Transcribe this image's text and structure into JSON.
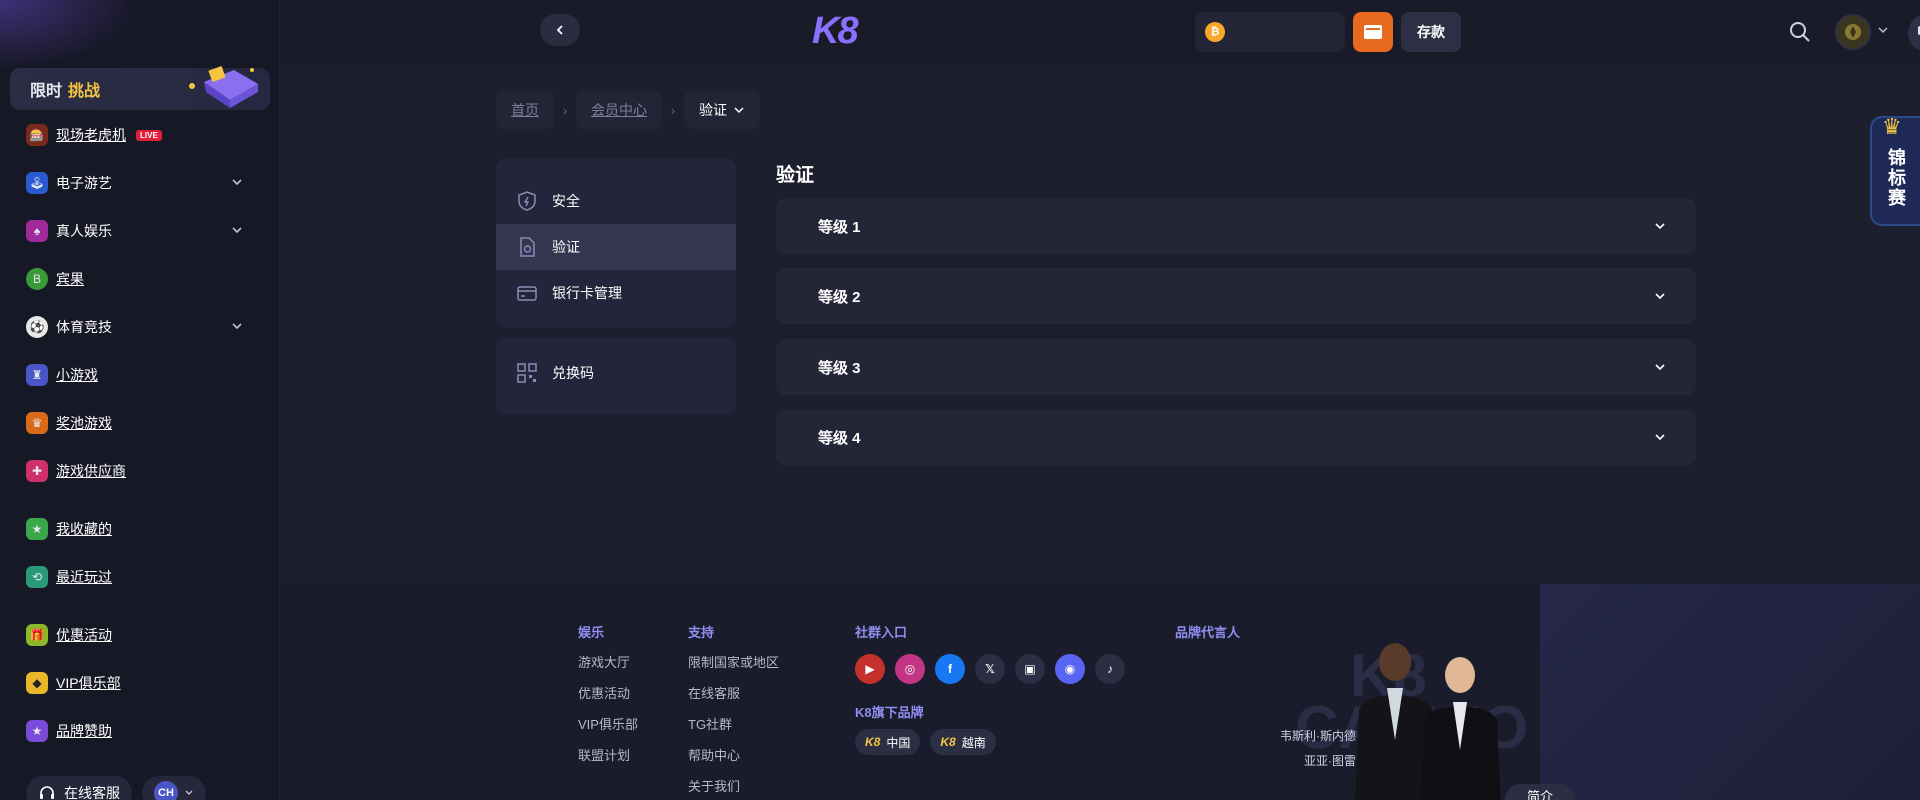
{
  "sidebar": {
    "promo": {
      "label": "限时",
      "highlight": "挑战"
    },
    "items": [
      {
        "label": "现场老虎机",
        "badge": "LIVE"
      },
      {
        "label": "电子游艺"
      },
      {
        "label": "真人娱乐"
      },
      {
        "label": "宾果"
      },
      {
        "label": "体育竞技"
      },
      {
        "label": "小游戏"
      },
      {
        "label": "奖池游戏"
      },
      {
        "label": "游戏供应商"
      },
      {
        "label": "我收藏的"
      },
      {
        "label": "最近玩过"
      },
      {
        "label": "优惠活动"
      },
      {
        "label": "VIP俱乐部"
      },
      {
        "label": "品牌赞助"
      }
    ],
    "support_label": "在线客服",
    "lang_code": "CH"
  },
  "header": {
    "logo": "K8",
    "deposit_label": "存款"
  },
  "breadcrumb": [
    {
      "label": "首页"
    },
    {
      "label": "会员中心"
    },
    {
      "label": "验证"
    }
  ],
  "menu": {
    "security": "安全",
    "verification": "验证",
    "bank_card": "银行卡管理",
    "redeem": "兑换码"
  },
  "content": {
    "title": "验证",
    "levels": [
      {
        "label": "等级 1"
      },
      {
        "label": "等级 2"
      },
      {
        "label": "等级 3"
      },
      {
        "label": "等级 4"
      }
    ]
  },
  "side_tab": {
    "label": "锦标赛"
  },
  "footer": {
    "entertainment": {
      "title": "娱乐",
      "links": [
        "游戏大厅",
        "优惠活动",
        "VIP俱乐部",
        "联盟计划"
      ]
    },
    "support": {
      "title": "支持",
      "links": [
        "限制国家或地区",
        "在线客服",
        "TG社群",
        "帮助中心",
        "关于我们"
      ]
    },
    "community": {
      "title": "社群入口"
    },
    "brands": {
      "title": "K8旗下品牌",
      "items": [
        "中国",
        "越南"
      ]
    },
    "ambassador": {
      "title": "品牌代言人",
      "names": [
        "韦斯利·斯内德",
        "亚亚·图雷"
      ],
      "more": "简介"
    },
    "watermark_1": "K8",
    "watermark_2": "CASINO"
  },
  "colors": {
    "accent": "#8a70ff",
    "wallet": "#e86a1f",
    "highlight": "#f5c542"
  }
}
